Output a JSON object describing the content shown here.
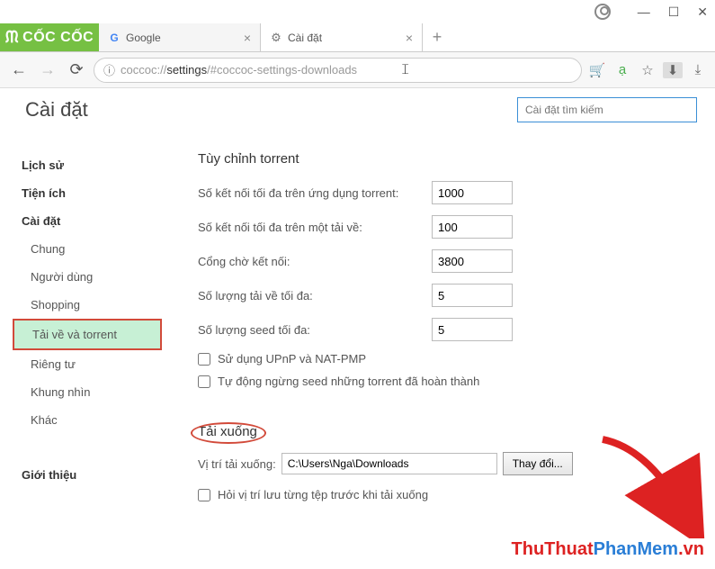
{
  "window": {
    "user_icon": "user",
    "minimize": "—",
    "maximize": "☐",
    "close": "✕"
  },
  "logo": "CỐC CỐC",
  "tabs": [
    {
      "favicon": "G",
      "title": "Google",
      "close": "×"
    },
    {
      "favicon": "⚙",
      "title": "Cài đặt",
      "close": "×"
    }
  ],
  "new_tab": "+",
  "nav": {
    "back": "←",
    "forward": "→",
    "reload": "⟳"
  },
  "addr": {
    "info": "ⓘ",
    "prefix": "coccoc://",
    "host": "settings",
    "suffix": "/#coccoc-settings-downloads"
  },
  "toolbar_icons": {
    "cart": "🛒",
    "a": "ạ",
    "star": "☆",
    "down": "⬇",
    "last": "⤓"
  },
  "page_title": "Cài đặt",
  "search_placeholder": "Cài đặt tìm kiếm",
  "sidebar": {
    "items": [
      "Lịch sử",
      "Tiện ích",
      "Cài đặt",
      "Chung",
      "Người dùng",
      "Shopping",
      "Tải về và torrent",
      "Riêng tư",
      "Khung nhìn",
      "Khác",
      "Giới thiệu"
    ]
  },
  "torrent": {
    "title": "Tùy chỉnh torrent",
    "rows": [
      {
        "label": "Số kết nối tối đa trên ứng dụng torrent:",
        "value": "1000"
      },
      {
        "label": "Số kết nối tối đa trên một tải về:",
        "value": "100"
      },
      {
        "label": "Cổng chờ kết nối:",
        "value": "3800"
      },
      {
        "label": "Số lượng tải về tối đa:",
        "value": "5"
      },
      {
        "label": "Số lượng seed tối đa:",
        "value": "5"
      }
    ],
    "checks": [
      "Sử dụng UPnP và NAT-PMP",
      "Tự động ngừng seed những torrent đã hoàn thành"
    ]
  },
  "download": {
    "title": "Tải xuống",
    "path_label": "Vị trí tải xuống:",
    "path_value": "C:\\Users\\Nga\\Downloads",
    "change_btn": "Thay đổi...",
    "ask_check": "Hỏi vị trí lưu từng tệp trước khi tải xuống"
  },
  "watermark": {
    "part1": "ThuThuat",
    "part2": "PhanMem",
    "part3": ".vn"
  }
}
